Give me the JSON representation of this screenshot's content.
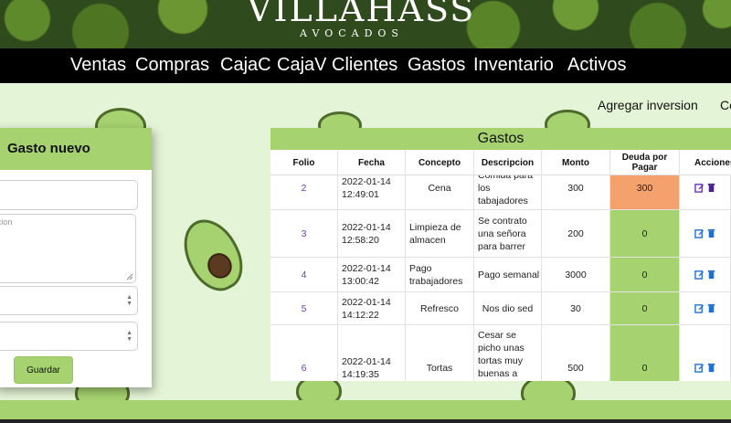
{
  "brand": {
    "name": "VILLAHASS",
    "sub": "AVOCADOS"
  },
  "nav": [
    "Ventas",
    "Compras",
    "CajaC",
    "CajaV",
    "Clientes",
    "Gastos",
    "Inventario",
    "Activos"
  ],
  "links": {
    "add_investment": "Agregar inversion",
    "other": "Ce"
  },
  "modal": {
    "title": "Gasto nuevo",
    "textarea_placeholder": "cion",
    "save_label": "Guardar"
  },
  "table": {
    "title": "Gastos",
    "headers": [
      "Folio",
      "Fecha",
      "Concepto",
      "Descripcion",
      "Monto",
      "Deuda por Pagar",
      "Acciones"
    ],
    "rows": [
      {
        "folio": "2",
        "fecha": "2022-01-14 12:49:01",
        "concepto": "Cena",
        "descripcion": "Comida para los tabajadores",
        "monto": "300",
        "deuda": "300",
        "deuda_status": "pending"
      },
      {
        "folio": "3",
        "fecha": "2022-01-14 12:58:20",
        "concepto": "Limpieza de almacen",
        "descripcion": "Se contrato una señora para barrer",
        "monto": "200",
        "deuda": "0",
        "deuda_status": "paid"
      },
      {
        "folio": "4",
        "fecha": "2022-01-14 13:00:42",
        "concepto": "Pago trabajadores",
        "descripcion": "Pago semanal",
        "monto": "3000",
        "deuda": "0",
        "deuda_status": "paid"
      },
      {
        "folio": "5",
        "fecha": "2022-01-14 14:12:22",
        "concepto": "Refresco",
        "descripcion": "Nos dio sed",
        "monto": "30",
        "deuda": "0",
        "deuda_status": "paid"
      },
      {
        "folio": "6",
        "fecha": "2022-01-14 14:19:35",
        "concepto": "Tortas",
        "descripcion": "Cesar se picho unas tortas muy buenas a",
        "monto": "500",
        "deuda": "0",
        "deuda_status": "paid"
      }
    ]
  },
  "colors": {
    "accent": "#a6d270",
    "debt_pending": "#f4a16e",
    "debt_paid": "#a6d270",
    "folio": "#6a40b8",
    "action_icon": "#1f6fd1"
  },
  "icons": [
    "edit-icon",
    "trash-icon",
    "spinner-icon"
  ]
}
